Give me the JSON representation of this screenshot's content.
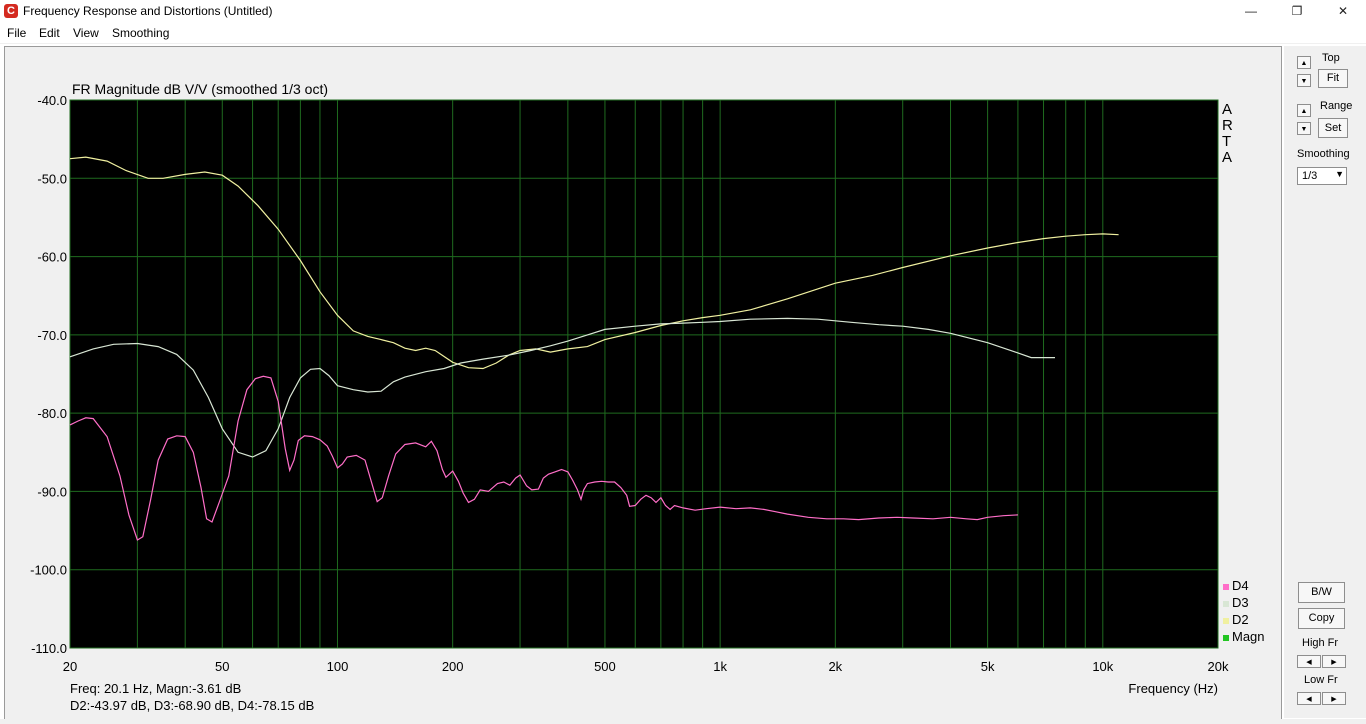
{
  "window": {
    "title": "Frequency Response and Distortions (Untitled)",
    "app_icon_letter": "C",
    "minimize_glyph": "—",
    "restore_glyph": "❐",
    "close_glyph": "✕"
  },
  "menu": [
    "File",
    "Edit",
    "View",
    "Smoothing"
  ],
  "controls": {
    "top_label": "Top",
    "fit_label": "Fit",
    "range_label": "Range",
    "set_label": "Set",
    "smoothing_label": "Smoothing",
    "smoothing_value": "1/3",
    "bw_label": "B/W",
    "copy_label": "Copy",
    "high_fr_label": "High Fr",
    "low_fr_label": "Low Fr",
    "up_glyph": "▲",
    "down_glyph": "▼",
    "left_glyph": "◀",
    "right_glyph": "▶"
  },
  "status": {
    "line1": "Freq: 20.1 Hz, Magn:-3.61 dB",
    "line2": "D2:-43.97 dB, D3:-68.90 dB, D4:-78.15 dB"
  },
  "colors": {
    "plot_bg": "#000000",
    "grid": "#1f6b1f",
    "d2": "#f0f0a0",
    "d3": "#d8e6d4",
    "d4": "#ff6ec8",
    "magn": "#22c522"
  },
  "chart_data": {
    "type": "line",
    "title": "FR Magnitude dB V/V (smoothed 1/3 oct)",
    "xlabel": "Frequency (Hz)",
    "ylabel": "",
    "watermark": "ARTA",
    "x_scale": "log",
    "xlim": [
      20,
      20000
    ],
    "ylim": [
      -110,
      -40
    ],
    "x_ticks": [
      {
        "v": 20,
        "label": "20"
      },
      {
        "v": 50,
        "label": "50"
      },
      {
        "v": 100,
        "label": "100"
      },
      {
        "v": 200,
        "label": "200"
      },
      {
        "v": 500,
        "label": "500"
      },
      {
        "v": 1000,
        "label": "1k"
      },
      {
        "v": 2000,
        "label": "2k"
      },
      {
        "v": 5000,
        "label": "5k"
      },
      {
        "v": 10000,
        "label": "10k"
      },
      {
        "v": 20000,
        "label": "20k"
      }
    ],
    "y_ticks": [
      {
        "v": -40,
        "label": "-40.0"
      },
      {
        "v": -50,
        "label": "-50.0"
      },
      {
        "v": -60,
        "label": "-60.0"
      },
      {
        "v": -70,
        "label": "-70.0"
      },
      {
        "v": -80,
        "label": "-80.0"
      },
      {
        "v": -90,
        "label": "-90.0"
      },
      {
        "v": -100,
        "label": "-100.0"
      },
      {
        "v": -110,
        "label": "-110.0"
      }
    ],
    "grid": true,
    "legend_placement": "bottom-right",
    "legend": [
      {
        "name": "D4",
        "color": "#ff6ec8"
      },
      {
        "name": "D3",
        "color": "#d8e6d4"
      },
      {
        "name": "D2",
        "color": "#f0f0a0"
      },
      {
        "name": "Magn",
        "color": "#22c522"
      }
    ],
    "series": [
      {
        "name": "D2",
        "color": "#f0f0a0",
        "points": [
          [
            20,
            -47.5
          ],
          [
            22,
            -47.3
          ],
          [
            25,
            -47.8
          ],
          [
            28,
            -49.0
          ],
          [
            32,
            -50.0
          ],
          [
            35,
            -50.0
          ],
          [
            40,
            -49.5
          ],
          [
            45,
            -49.2
          ],
          [
            50,
            -49.6
          ],
          [
            55,
            -51.0
          ],
          [
            62,
            -53.5
          ],
          [
            70,
            -56.5
          ],
          [
            80,
            -60.5
          ],
          [
            90,
            -64.5
          ],
          [
            100,
            -67.5
          ],
          [
            110,
            -69.5
          ],
          [
            120,
            -70.2
          ],
          [
            130,
            -70.6
          ],
          [
            140,
            -71.0
          ],
          [
            150,
            -71.7
          ],
          [
            160,
            -72.0
          ],
          [
            170,
            -71.7
          ],
          [
            180,
            -72.0
          ],
          [
            200,
            -73.5
          ],
          [
            220,
            -74.2
          ],
          [
            240,
            -74.3
          ],
          [
            260,
            -73.6
          ],
          [
            280,
            -72.6
          ],
          [
            300,
            -72.0
          ],
          [
            330,
            -71.8
          ],
          [
            360,
            -72.2
          ],
          [
            400,
            -71.8
          ],
          [
            450,
            -71.5
          ],
          [
            500,
            -70.6
          ],
          [
            600,
            -69.7
          ],
          [
            700,
            -68.8
          ],
          [
            800,
            -68.2
          ],
          [
            900,
            -67.8
          ],
          [
            1000,
            -67.5
          ],
          [
            1200,
            -66.8
          ],
          [
            1500,
            -65.4
          ],
          [
            2000,
            -63.4
          ],
          [
            2500,
            -62.4
          ],
          [
            3000,
            -61.4
          ],
          [
            4000,
            -59.9
          ],
          [
            5000,
            -58.9
          ],
          [
            6000,
            -58.2
          ],
          [
            7000,
            -57.7
          ],
          [
            8000,
            -57.4
          ],
          [
            9000,
            -57.2
          ],
          [
            10000,
            -57.1
          ],
          [
            11000,
            -57.2
          ]
        ]
      },
      {
        "name": "D3",
        "color": "#d8e6d4",
        "points": [
          [
            20,
            -72.8
          ],
          [
            23,
            -71.8
          ],
          [
            26,
            -71.2
          ],
          [
            30,
            -71.1
          ],
          [
            34,
            -71.5
          ],
          [
            38,
            -72.5
          ],
          [
            42,
            -74.5
          ],
          [
            46,
            -78.0
          ],
          [
            50,
            -82.0
          ],
          [
            55,
            -85.0
          ],
          [
            60,
            -85.6
          ],
          [
            65,
            -84.8
          ],
          [
            70,
            -82.0
          ],
          [
            75,
            -78.0
          ],
          [
            80,
            -75.5
          ],
          [
            85,
            -74.4
          ],
          [
            90,
            -74.3
          ],
          [
            95,
            -75.2
          ],
          [
            100,
            -76.5
          ],
          [
            110,
            -77.0
          ],
          [
            120,
            -77.3
          ],
          [
            130,
            -77.2
          ],
          [
            140,
            -76.0
          ],
          [
            150,
            -75.4
          ],
          [
            170,
            -74.7
          ],
          [
            190,
            -74.3
          ],
          [
            210,
            -73.6
          ],
          [
            240,
            -73.1
          ],
          [
            280,
            -72.6
          ],
          [
            320,
            -72.0
          ],
          [
            360,
            -71.4
          ],
          [
            400,
            -70.8
          ],
          [
            450,
            -70.0
          ],
          [
            500,
            -69.3
          ],
          [
            600,
            -68.9
          ],
          [
            700,
            -68.6
          ],
          [
            800,
            -68.5
          ],
          [
            900,
            -68.4
          ],
          [
            1000,
            -68.3
          ],
          [
            1200,
            -68.0
          ],
          [
            1500,
            -67.9
          ],
          [
            1800,
            -68.0
          ],
          [
            2200,
            -68.4
          ],
          [
            2600,
            -68.7
          ],
          [
            3000,
            -68.9
          ],
          [
            3500,
            -69.3
          ],
          [
            4000,
            -69.8
          ],
          [
            5000,
            -71.0
          ],
          [
            6000,
            -72.3
          ],
          [
            6500,
            -72.9
          ],
          [
            7500,
            -72.9
          ]
        ]
      },
      {
        "name": "D4",
        "color": "#ff6ec8",
        "points": [
          [
            20,
            -81.5
          ],
          [
            21,
            -81.0
          ],
          [
            22,
            -80.6
          ],
          [
            23,
            -80.7
          ],
          [
            25,
            -83.0
          ],
          [
            27,
            -88.0
          ],
          [
            28.5,
            -93.0
          ],
          [
            30,
            -96.2
          ],
          [
            31,
            -95.8
          ],
          [
            32.5,
            -91.0
          ],
          [
            34,
            -86.0
          ],
          [
            36,
            -83.3
          ],
          [
            38,
            -82.9
          ],
          [
            40,
            -83.0
          ],
          [
            42,
            -85.0
          ],
          [
            44,
            -89.5
          ],
          [
            45.5,
            -93.5
          ],
          [
            47,
            -93.9
          ],
          [
            49,
            -91.5
          ],
          [
            52,
            -88.0
          ],
          [
            55,
            -81.0
          ],
          [
            58,
            -77.0
          ],
          [
            61,
            -75.6
          ],
          [
            64,
            -75.3
          ],
          [
            67,
            -75.5
          ],
          [
            70,
            -78.5
          ],
          [
            73,
            -84.5
          ],
          [
            75,
            -87.3
          ],
          [
            77,
            -86.0
          ],
          [
            79,
            -83.5
          ],
          [
            82,
            -82.9
          ],
          [
            86,
            -83.0
          ],
          [
            90,
            -83.4
          ],
          [
            94,
            -84.2
          ],
          [
            97,
            -85.5
          ],
          [
            100,
            -87.0
          ],
          [
            103,
            -86.5
          ],
          [
            106,
            -85.6
          ],
          [
            112,
            -85.4
          ],
          [
            118,
            -86.0
          ],
          [
            123,
            -89.0
          ],
          [
            127,
            -91.3
          ],
          [
            131,
            -90.8
          ],
          [
            136,
            -88.0
          ],
          [
            142,
            -85.2
          ],
          [
            150,
            -84.0
          ],
          [
            160,
            -83.8
          ],
          [
            170,
            -84.3
          ],
          [
            176,
            -83.6
          ],
          [
            182,
            -84.8
          ],
          [
            188,
            -87.2
          ],
          [
            192,
            -88.2
          ],
          [
            200,
            -87.4
          ],
          [
            207,
            -88.7
          ],
          [
            213,
            -90.2
          ],
          [
            220,
            -91.4
          ],
          [
            228,
            -91.0
          ],
          [
            236,
            -89.8
          ],
          [
            248,
            -90.0
          ],
          [
            262,
            -89.0
          ],
          [
            272,
            -88.8
          ],
          [
            282,
            -89.2
          ],
          [
            292,
            -88.3
          ],
          [
            300,
            -87.9
          ],
          [
            312,
            -89.3
          ],
          [
            322,
            -89.8
          ],
          [
            335,
            -89.7
          ],
          [
            345,
            -88.3
          ],
          [
            356,
            -87.8
          ],
          [
            370,
            -87.5
          ],
          [
            385,
            -87.2
          ],
          [
            400,
            -87.5
          ],
          [
            412,
            -88.6
          ],
          [
            424,
            -89.8
          ],
          [
            433,
            -91.0
          ],
          [
            440,
            -89.8
          ],
          [
            450,
            -89.0
          ],
          [
            470,
            -88.8
          ],
          [
            490,
            -88.7
          ],
          [
            510,
            -88.8
          ],
          [
            530,
            -88.8
          ],
          [
            550,
            -89.5
          ],
          [
            570,
            -90.5
          ],
          [
            580,
            -91.9
          ],
          [
            600,
            -91.8
          ],
          [
            620,
            -91.0
          ],
          [
            640,
            -90.5
          ],
          [
            660,
            -90.8
          ],
          [
            680,
            -91.4
          ],
          [
            700,
            -90.8
          ],
          [
            720,
            -91.8
          ],
          [
            740,
            -92.3
          ],
          [
            760,
            -91.8
          ],
          [
            800,
            -92.1
          ],
          [
            860,
            -92.4
          ],
          [
            920,
            -92.2
          ],
          [
            1000,
            -92.0
          ],
          [
            1100,
            -92.2
          ],
          [
            1200,
            -92.1
          ],
          [
            1300,
            -92.3
          ],
          [
            1400,
            -92.6
          ],
          [
            1500,
            -92.9
          ],
          [
            1700,
            -93.3
          ],
          [
            1900,
            -93.5
          ],
          [
            2100,
            -93.5
          ],
          [
            2300,
            -93.6
          ],
          [
            2600,
            -93.4
          ],
          [
            2900,
            -93.3
          ],
          [
            3200,
            -93.4
          ],
          [
            3600,
            -93.5
          ],
          [
            4000,
            -93.3
          ],
          [
            4400,
            -93.5
          ],
          [
            4700,
            -93.6
          ],
          [
            5000,
            -93.3
          ],
          [
            5500,
            -93.1
          ],
          [
            6000,
            -93.0
          ]
        ]
      }
    ]
  }
}
